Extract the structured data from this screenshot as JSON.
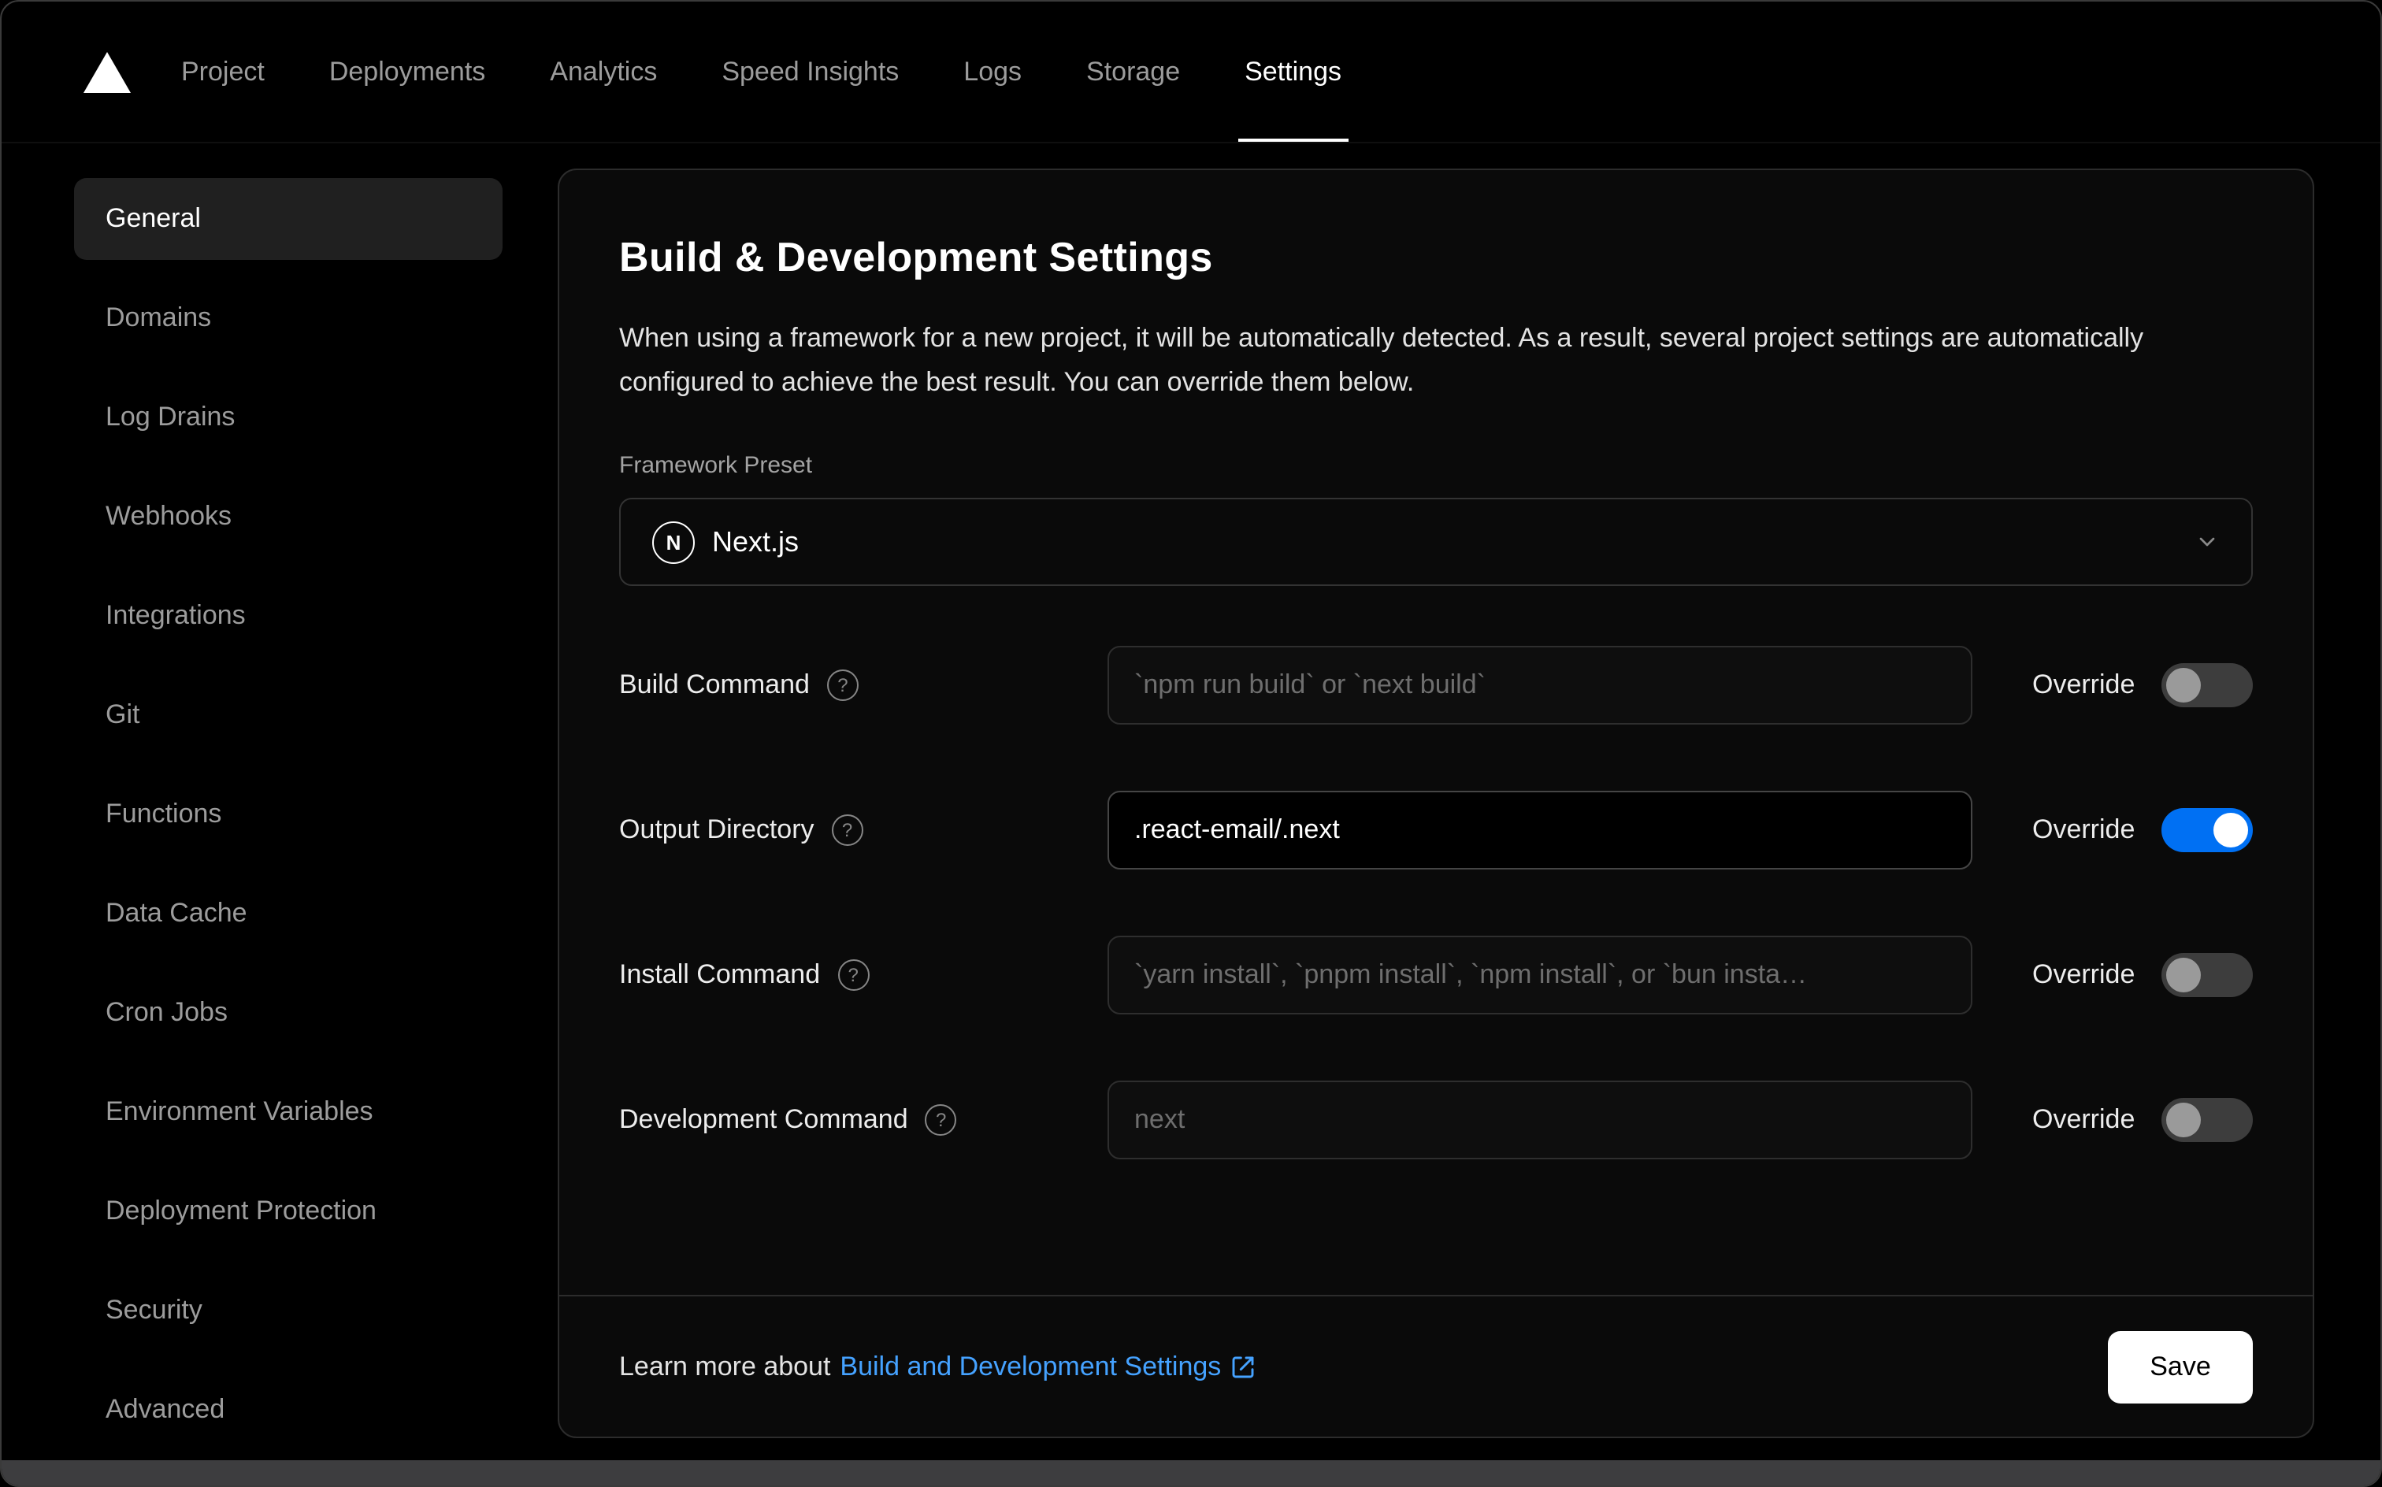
{
  "nav": {
    "items": [
      {
        "label": "Project"
      },
      {
        "label": "Deployments"
      },
      {
        "label": "Analytics"
      },
      {
        "label": "Speed Insights"
      },
      {
        "label": "Logs"
      },
      {
        "label": "Storage"
      },
      {
        "label": "Settings"
      }
    ],
    "active": "Settings"
  },
  "sidebar": {
    "items": [
      {
        "label": "General"
      },
      {
        "label": "Domains"
      },
      {
        "label": "Log Drains"
      },
      {
        "label": "Webhooks"
      },
      {
        "label": "Integrations"
      },
      {
        "label": "Git"
      },
      {
        "label": "Functions"
      },
      {
        "label": "Data Cache"
      },
      {
        "label": "Cron Jobs"
      },
      {
        "label": "Environment Variables"
      },
      {
        "label": "Deployment Protection"
      },
      {
        "label": "Security"
      },
      {
        "label": "Advanced"
      }
    ],
    "active": "General"
  },
  "settings": {
    "title": "Build & Development Settings",
    "description": "When using a framework for a new project, it will be automatically detected. As a result, several project settings are automatically configured to achieve the best result. You can override them below.",
    "framework_preset": {
      "label": "Framework Preset",
      "value": "Next.js"
    },
    "override_label": "Override",
    "rows": [
      {
        "label": "Build Command",
        "placeholder": "`npm run build` or `next build`",
        "value": "",
        "override": false
      },
      {
        "label": "Output Directory",
        "placeholder": "",
        "value": ".react-email/.next",
        "override": true
      },
      {
        "label": "Install Command",
        "placeholder": "`yarn install`, `pnpm install`, `npm install`, or `bun insta…",
        "value": "",
        "override": false
      },
      {
        "label": "Development Command",
        "placeholder": "next",
        "value": "",
        "override": false
      }
    ],
    "footer": {
      "learn_more_prefix": "Learn more about",
      "link_text": "Build and Development Settings",
      "save_label": "Save"
    }
  },
  "icons": {
    "help": "?",
    "nextjs_letter": "N"
  },
  "colors": {
    "accent_blue": "#0070f3",
    "link_blue": "#45a2ff"
  }
}
